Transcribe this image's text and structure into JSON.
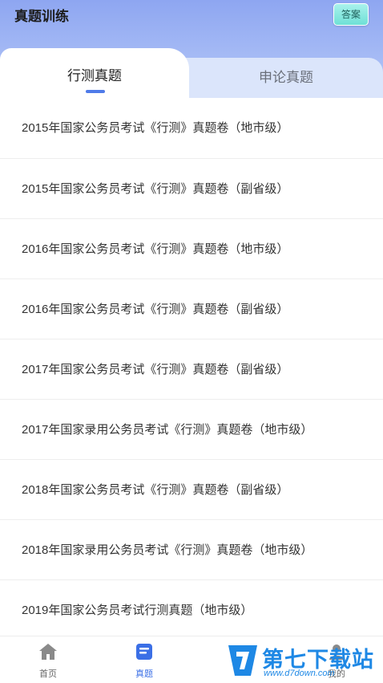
{
  "header": {
    "title": "真题训练",
    "answer_button": "答案"
  },
  "tabs": [
    {
      "label": "行测真题",
      "active": true
    },
    {
      "label": "申论真题",
      "active": false
    }
  ],
  "list_items": [
    "2015年国家公务员考试《行测》真题卷（地市级）",
    "2015年国家公务员考试《行测》真题卷（副省级）",
    "2016年国家公务员考试《行测》真题卷（地市级）",
    "2016年国家公务员考试《行测》真题卷（副省级）",
    "2017年国家公务员考试《行测》真题卷（副省级）",
    "2017年国家录用公务员考试《行测》真题卷（地市级）",
    "2018年国家公务员考试《行测》真题卷（副省级）",
    "2018年国家录用公务员考试《行测》真题卷（地市级）",
    "2019年国家公务员考试行测真题（地市级）"
  ],
  "bottom_nav": [
    {
      "label": "首页",
      "icon": "home-icon",
      "active": false
    },
    {
      "label": "真题",
      "icon": "document-icon",
      "active": true
    },
    {
      "label": "我的",
      "icon": "profile-icon",
      "active": false
    }
  ],
  "watermark": {
    "title": "第七下载站",
    "url": "www.d7down.com"
  },
  "colors": {
    "accent": "#3b6fe6",
    "header_bg": "#9db3f4",
    "answer_bg": "#7ee4db"
  }
}
